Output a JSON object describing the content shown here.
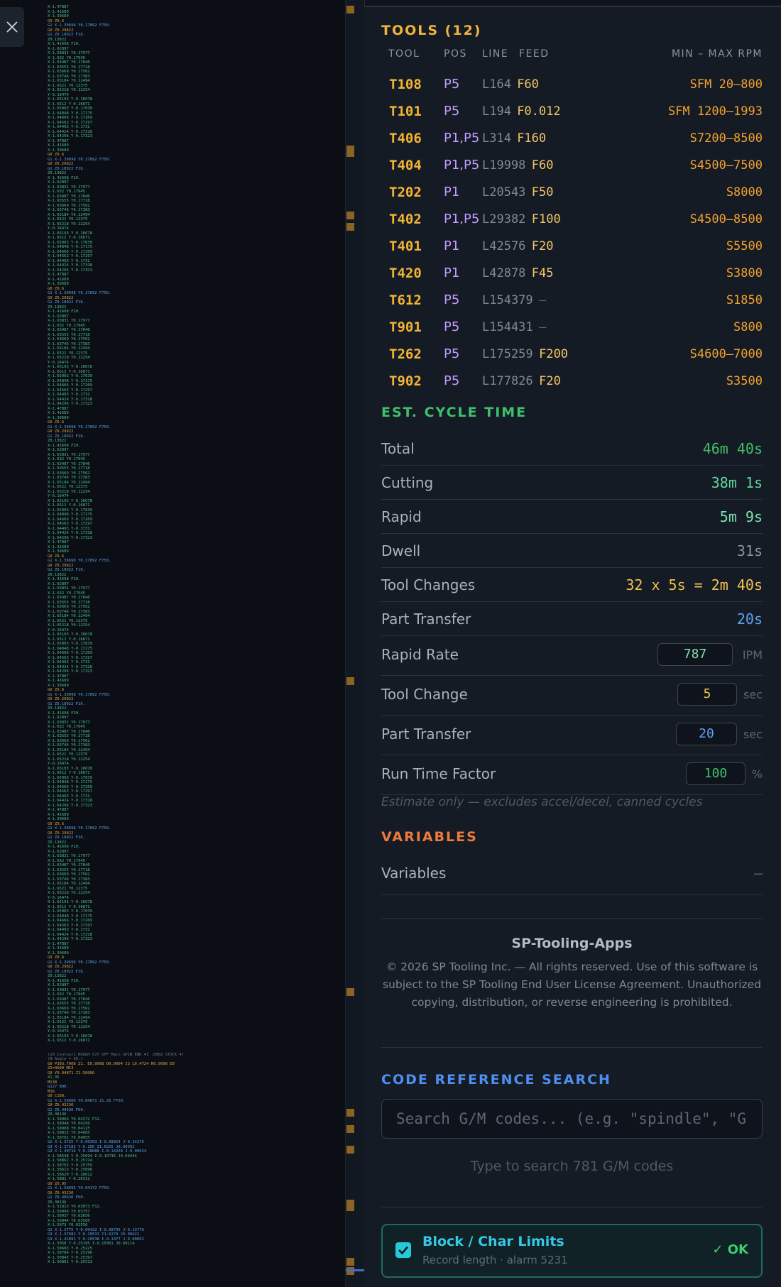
{
  "tools": {
    "title": "TOOLS (12)",
    "headers": {
      "tool": "TOOL",
      "pos": "POS",
      "line": "LINE",
      "feed": "FEED",
      "rpm": "MIN – MAX RPM"
    },
    "rows": [
      {
        "id": "T108",
        "pos": "P5",
        "line": "L164",
        "feed": "F60",
        "rpm": "SFM 20–800"
      },
      {
        "id": "T101",
        "pos": "P5",
        "line": "L194",
        "feed": "F0.012",
        "rpm": "SFM 1200–1993"
      },
      {
        "id": "T406",
        "pos": "P1,P5",
        "line": "L314",
        "feed": "F160",
        "rpm": "S7200–8500"
      },
      {
        "id": "T404",
        "pos": "P1,P5",
        "line": "L19998",
        "feed": "F60",
        "rpm": "S4500–7500"
      },
      {
        "id": "T202",
        "pos": "P1",
        "line": "L20543",
        "feed": "F50",
        "rpm": "S8000"
      },
      {
        "id": "T402",
        "pos": "P1,P5",
        "line": "L29382",
        "feed": "F100",
        "rpm": "S4500–8500"
      },
      {
        "id": "T401",
        "pos": "P1",
        "line": "L42576",
        "feed": "F20",
        "rpm": "S5500"
      },
      {
        "id": "T420",
        "pos": "P1",
        "line": "L42878",
        "feed": "F45",
        "rpm": "S3800"
      },
      {
        "id": "T612",
        "pos": "P5",
        "line": "L154379",
        "feed": "—",
        "rpm": "S1850"
      },
      {
        "id": "T901",
        "pos": "P5",
        "line": "L154431",
        "feed": "—",
        "rpm": "S800"
      },
      {
        "id": "T262",
        "pos": "P5",
        "line": "L175259",
        "feed": "F200",
        "rpm": "S4600–7000"
      },
      {
        "id": "T902",
        "pos": "P5",
        "line": "L177826",
        "feed": "F20",
        "rpm": "S3500"
      }
    ]
  },
  "cycle": {
    "title": "EST. CYCLE TIME",
    "stats": [
      {
        "label": "Total",
        "value": "46m 40s",
        "color": "#3fbf6a"
      },
      {
        "label": "Cutting",
        "value": "38m 1s",
        "color": "#5fd6a0"
      },
      {
        "label": "Rapid",
        "value": "5m 9s",
        "color": "#7fe0b0"
      },
      {
        "label": "Dwell",
        "value": "31s",
        "color": "#8b94a2"
      },
      {
        "label": "Tool Changes",
        "value": "32 x 5s = 2m 40s",
        "color": "#f2c14e"
      },
      {
        "label": "Part Transfer",
        "value": "20s",
        "color": "#5fa0f0"
      }
    ],
    "inputs": [
      {
        "label": "Rapid Rate",
        "value": "787",
        "unit": "IPM",
        "color": "#7fe0b0"
      },
      {
        "label": "Tool Change",
        "value": "5",
        "unit": "sec",
        "color": "#f2c14e"
      },
      {
        "label": "Part Transfer",
        "value": "20",
        "unit": "sec",
        "color": "#5fa0f0"
      },
      {
        "label": "Run Time Factor",
        "value": "100",
        "unit": "%",
        "color": "#3fbf6a"
      }
    ],
    "note": "Estimate only — excludes accel/decel, canned cycles"
  },
  "variables": {
    "title": "VARIABLES",
    "label": "Variables",
    "value": "—"
  },
  "footer": {
    "brand": "SP-Tooling-Apps",
    "copyright": "© 2026 SP Tooling Inc. — All rights reserved. Use of this software is subject to the SP Tooling End User License Agreement. Unauthorized copying, distribution, or reverse engineering is prohibited."
  },
  "search": {
    "title": "CODE REFERENCE SEARCH",
    "placeholder": "Search G/M codes... (e.g. \"spindle\", \"G",
    "hint": "Type to search 781 G/M codes"
  },
  "limits": {
    "title": "Block / Char Limits",
    "subtitle": "Record length · alarm 5231",
    "status": "✓ OK"
  },
  "code_sample": {
    "lines": [
      "X-1.47887",
      "X-1.41689",
      "X-1.39689",
      "G0 Z0.6",
      "G1 X-1.39698 Y0.17892 F750.",
      "G0 Z0.29822",
      "G1 Z0.18922 F16.",
      "Z0.13822",
      "X-1.41698 F20.",
      "X-1.62897",
      "X-1.63831 Y0.17977",
      "X-1.632 Y0.17945",
      "X-1.63487 Y0.17846",
      "X-1.63555 Y0.17718",
      "X-1.63669 Y0.17562",
      "X-1.63746 Y0.17383",
      "X-1.65184 Y0.12494",
      "X-1.6521 Y0.12375",
      "X-1.65218 Y0.12254",
      "Y-0.16474",
      "X-1.65193 Y-0.16678",
      "X-1.6512 Y-0.16871",
      "X-1.65003 Y-0.17039",
      "X-1.64848 Y-0.17175",
      "X-1.64666 Y-0.17269",
      "X-1.64563 Y-0.17297",
      "X-1.64493 Y-0.1731",
      "X-1.64424 Y-0.17318",
      "X-1.64296 Y-0.17323"
    ],
    "tail": [
      "(20 Contour1 ROUGH CUT OFF Main SPIN END 41 .0002 STOCK 4)",
      "(B Angle = 90.)",
      "G0 P393.7008 Z1. E0.0008 D0.0004 I3 L0.4724 R0.0098 E0",
      "S5=4600 M13",
      "G0 Y0.04871 Z1.58966",
      "X1.35",
      "M138",
      "G127 B90.",
      "M16",
      "G0 C180.",
      "G1 X-1.58966 Y0.04871 Z1.35 F750.",
      "G0 Z0.43236",
      "G1 Z0.40636 F60.",
      "Z0.38136",
      "X-1.58966 Y0.04372 F12.",
      "X-1.58948 Y0.04256",
      "X-1.58908 Y0.04115",
      "X-1.58815 Y0.04005",
      "X-1.58702 Y0.04055",
      "G2 X-1.3725 Y-0.09393 I-0.08824 J-0.14275",
      "G3 X-1.37183 Y-0.105 I1.6225 J0.09392",
      "G3 X-1.40716 Y-0.28888 I-0.14269 J-0.00924",
      "X-1.58548 Y-0.25694 I-0.10736 J0.09444",
      "X-1.58862 Y-0.25724",
      "X-1.58755 Y-0.25755",
      "X-1.58613 Y-0.25896",
      "X-1.58629 Y-0.26012",
      "X-1.5881 Y-0.26311",
      "G0 Z0.95",
      "G1 X-1.58995 Y0.04172 F750.",
      "G0 Z0.43236",
      "G1 Z0.40636 F60.",
      "Z0.38136",
      "X-1.51813 Y0.03873 F12.",
      "X-1.50996 Y0.03757",
      "X-1.50937 Y0.03656",
      "X-1.50844 Y0.03585",
      "X-1.5073 Y0.03556",
      "G2 X-1.3775 Y-0.09422 I-0.08795 J-0.13776",
      "G3 X-1.37682 Y-0.10531 I1.6279 J0.09421",
      "G3 X-1.41891 Y-0.20538 I-0.1377 J-0.00891",
      "X-1.5058 Y-0.25195 I-0.10301 J0.09114",
      "X-1.50693 Y-0.25225",
      "X-1.50784 Y-0.25296",
      "X-1.50845 Y-0.25397",
      "X-1.50861 Y-0.25513"
    ]
  },
  "colors": {
    "tool_id": "#f4b433",
    "pos": "#c39bff",
    "rpm": "#f0a030",
    "feed": "#f2c56a",
    "cycle_title": "#3fbf6a",
    "vars_title": "#f07a3a",
    "search_title": "#4f8ff0",
    "ok": "#3ccf6e"
  },
  "icons": {
    "close": "close-icon",
    "checkbox": "checkbox-checked-icon",
    "ok": "check-icon"
  }
}
